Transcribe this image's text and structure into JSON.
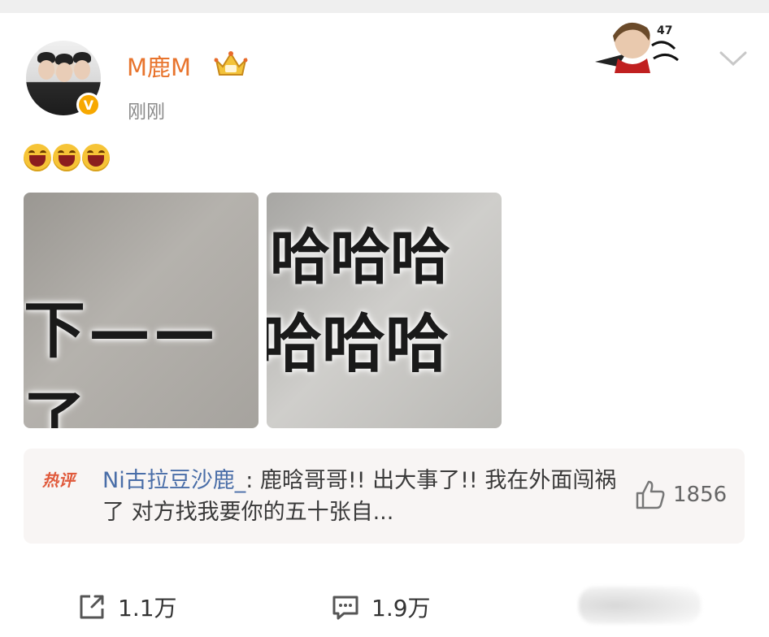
{
  "post": {
    "username": "M鹿M",
    "time": "刚刚",
    "verified_badge": "V",
    "emoji_icon": "laughing-face-icon",
    "emoji_count": 3
  },
  "photos": {
    "left_text": "下——了",
    "right_text_line1": "哈哈哈",
    "right_text_line2": "哈哈哈"
  },
  "hot_comment": {
    "label": "热评",
    "user": "Ni古拉豆沙鹿_",
    "text": ": 鹿晗哥哥!! 出大事了!! 我在外面闯祸了 对方找我要你的五十张自...",
    "likes": "1856"
  },
  "actions": {
    "share_count": "1.1万",
    "comment_count": "1.9万"
  },
  "colors": {
    "username": "#e8742d",
    "hot_label": "#e05a3c",
    "comment_user": "#4a6ea8"
  }
}
